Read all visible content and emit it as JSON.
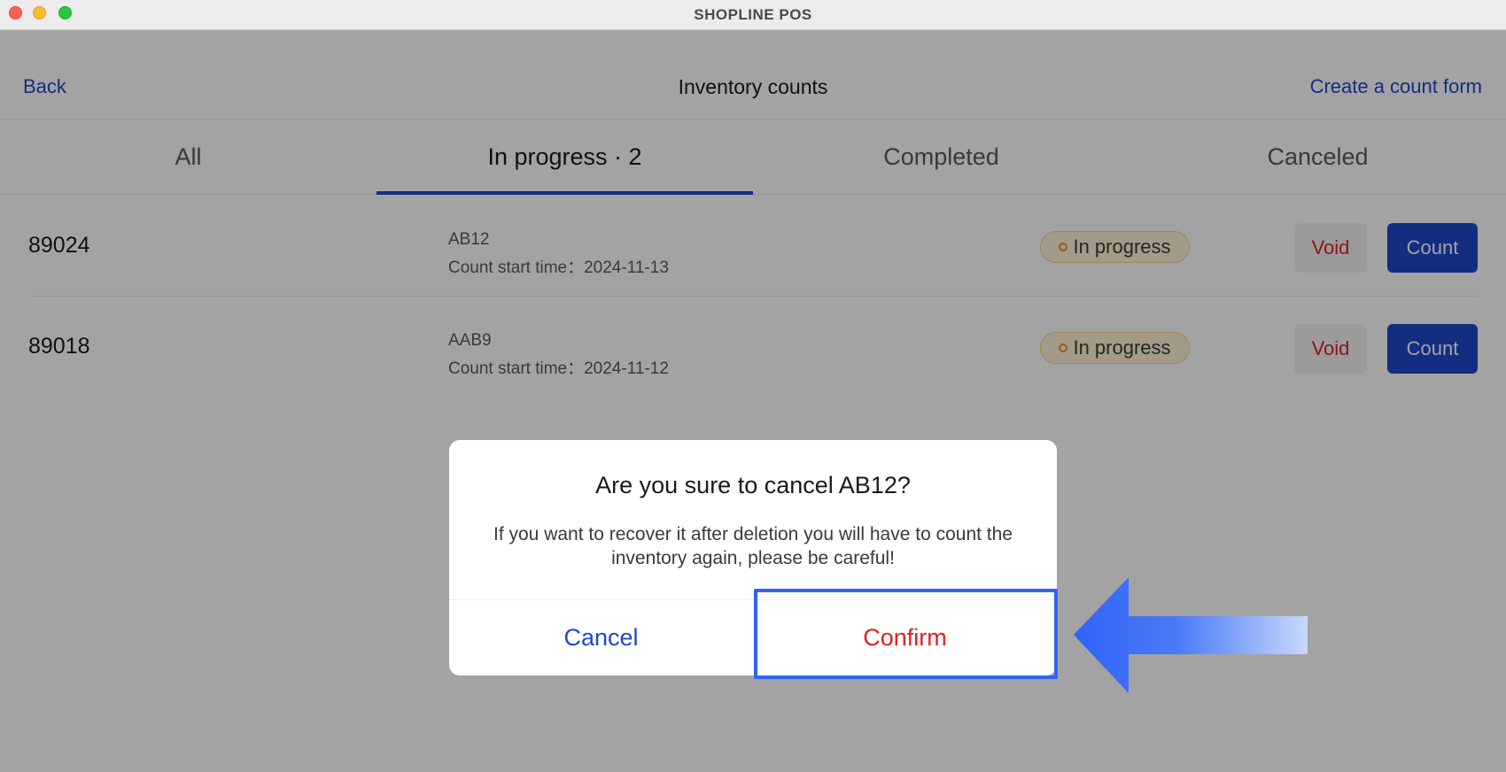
{
  "window": {
    "title": "SHOPLINE POS"
  },
  "header": {
    "back_label": "Back",
    "title": "Inventory counts",
    "create_label": "Create a count form"
  },
  "tabs": [
    {
      "label": "All"
    },
    {
      "label": "In progress · 2"
    },
    {
      "label": "Completed"
    },
    {
      "label": "Canceled"
    }
  ],
  "rows": [
    {
      "id": "89024",
      "code": "AB12",
      "start_time": "Count start time：2024-11-13",
      "status": "In progress",
      "void_label": "Void",
      "count_label": "Count"
    },
    {
      "id": "89018",
      "code": "AAB9",
      "start_time": "Count start time：2024-11-12",
      "status": "In progress",
      "void_label": "Void",
      "count_label": "Count"
    }
  ],
  "dialog": {
    "title": "Are you sure to cancel AB12?",
    "message": "If you want to recover it after deletion you will have to count the inventory again, please be careful!",
    "cancel_label": "Cancel",
    "confirm_label": "Confirm"
  },
  "colors": {
    "accent": "#1f47c9",
    "danger": "#e02020",
    "badge_bg": "#fff2d4",
    "highlight": "#2f63f5"
  }
}
